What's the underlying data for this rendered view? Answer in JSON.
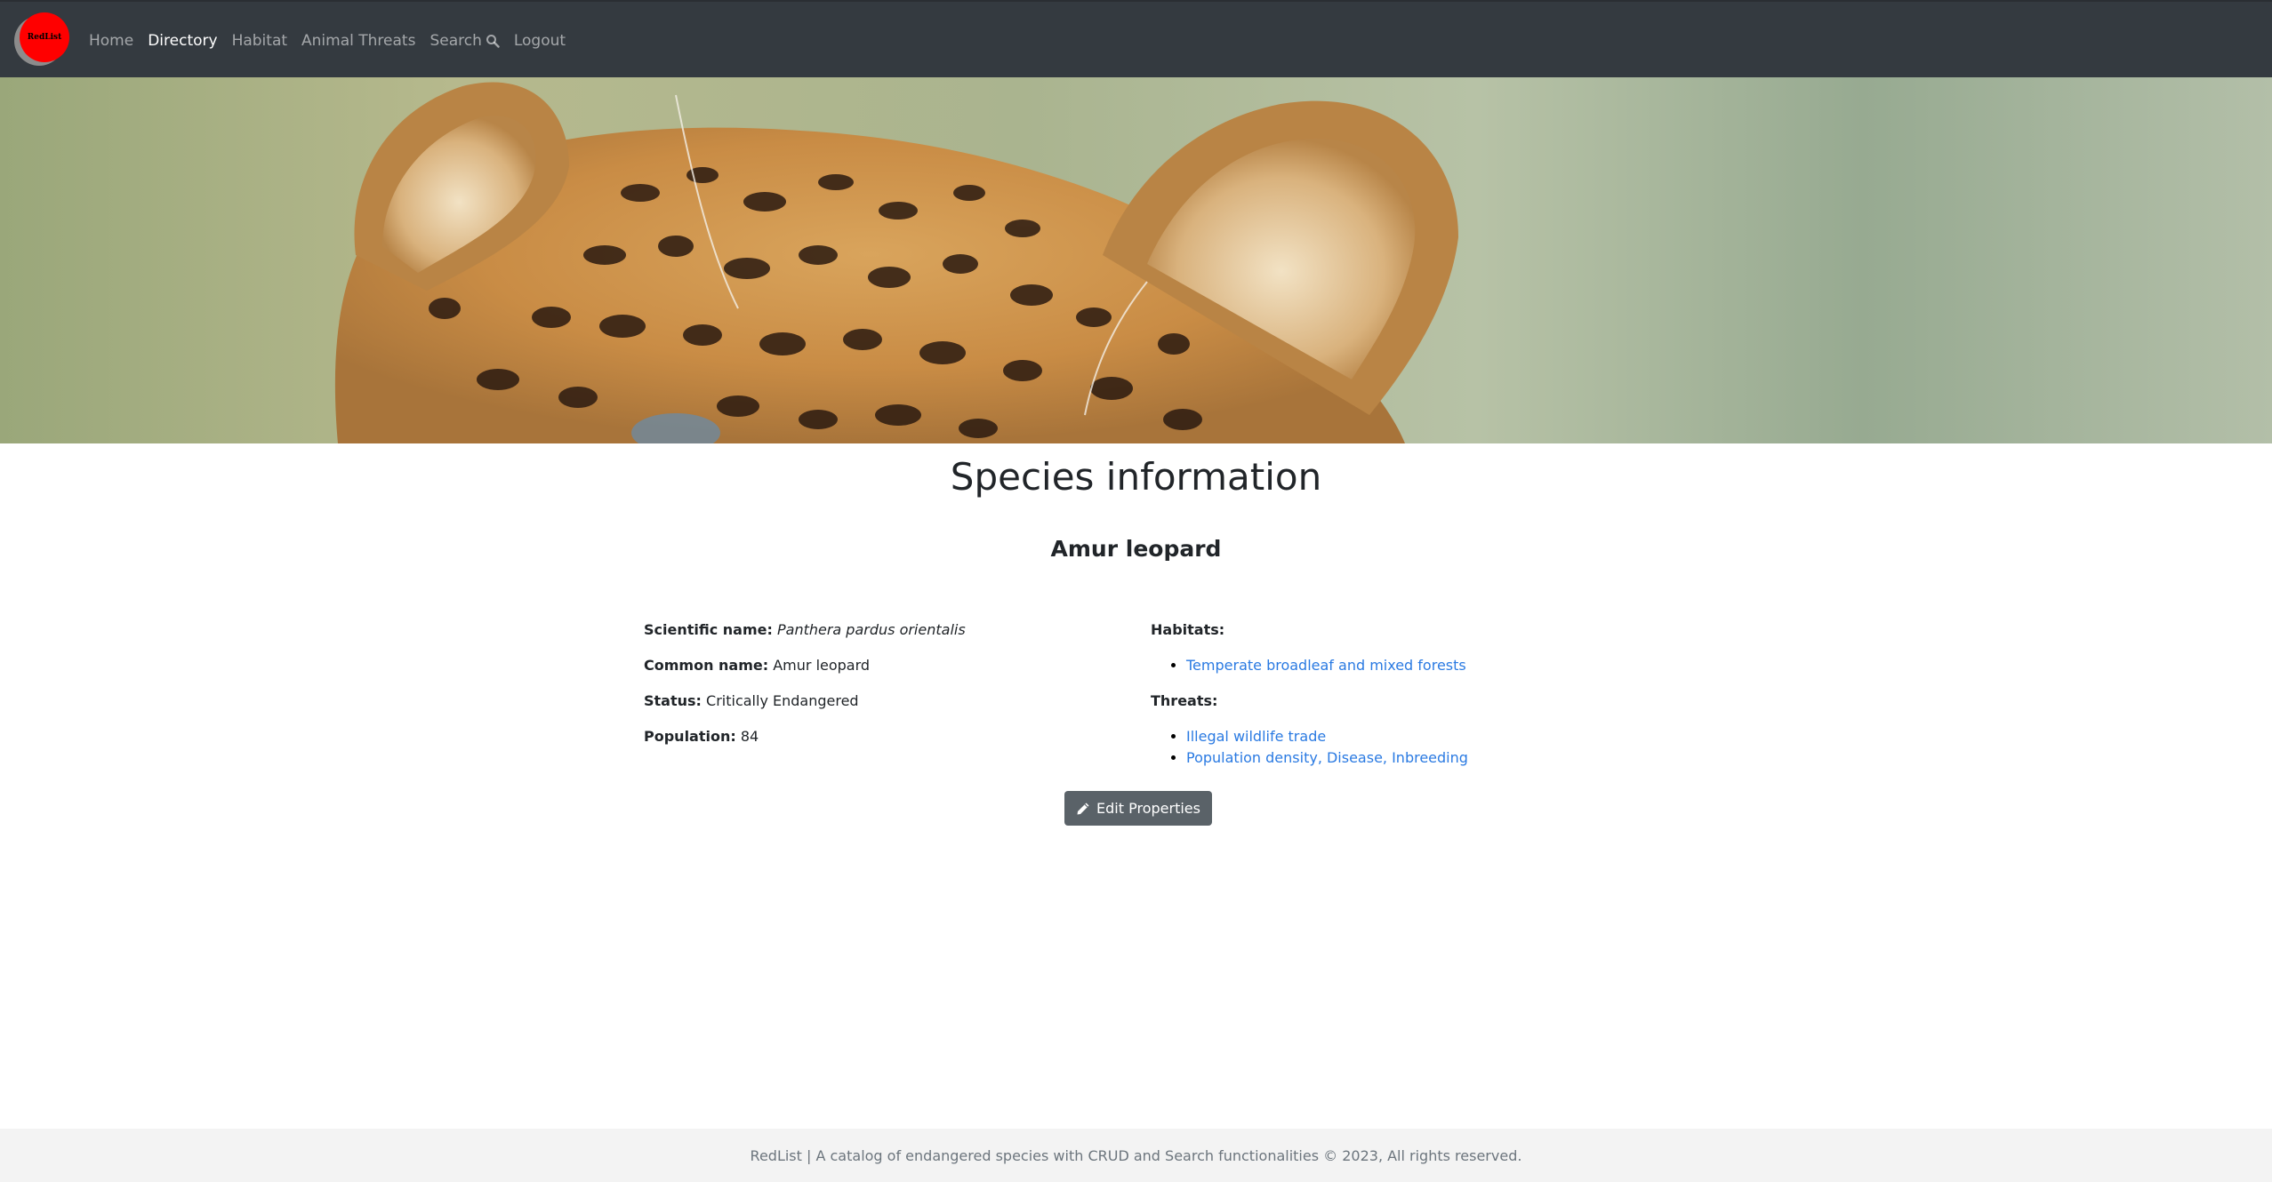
{
  "navbar": {
    "brand_text": "RedList",
    "links": [
      {
        "label": "Home",
        "active": false
      },
      {
        "label": "Directory",
        "active": true
      },
      {
        "label": "Habitat",
        "active": false
      },
      {
        "label": "Animal Threats",
        "active": false
      },
      {
        "label": "Search",
        "active": false,
        "icon": "search-icon"
      },
      {
        "label": "Logout",
        "active": false
      }
    ]
  },
  "hero": {
    "image": "leopard-head-closeup"
  },
  "page": {
    "title": "Species information",
    "species_heading": "Amur leopard"
  },
  "properties": {
    "scientific_name_label": "Scientific name:",
    "scientific_name": "Panthera pardus orientalis",
    "common_name_label": "Common name:",
    "common_name": "Amur leopard",
    "status_label": "Status:",
    "status": "Critically Endangered",
    "population_label": "Population:",
    "population": "84"
  },
  "habitats": {
    "label": "Habitats:",
    "items": [
      "Temperate broadleaf and mixed forests"
    ]
  },
  "threats": {
    "label": "Threats:",
    "items": [
      "Illegal wildlife trade",
      "Population density, Disease, Inbreeding"
    ]
  },
  "edit_button": {
    "label": "Edit Properties",
    "icon": "pencil-icon"
  },
  "footer": {
    "text": "RedList | A catalog of endangered species with CRUD and Search functionalities © 2023, All rights reserved."
  },
  "colors": {
    "navbar_bg": "#343a40",
    "brand_red": "#ff0000",
    "link_blue": "#2a7ae2",
    "button_bg": "#5a6268",
    "footer_bg": "#f3f3f3"
  }
}
